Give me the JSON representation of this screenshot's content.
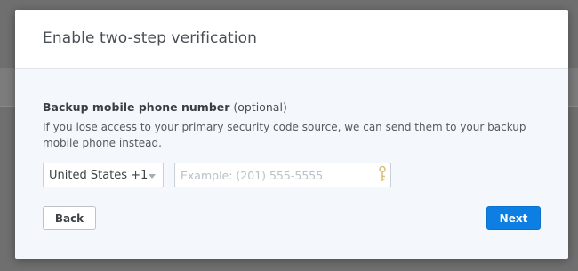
{
  "dialog": {
    "title": "Enable two-step verification"
  },
  "backup_phone": {
    "label": "Backup mobile phone number",
    "optional_note": "(optional)",
    "description": "If you lose access to your primary security code source, we can send them to your backup mobile phone instead.",
    "country_select": {
      "selected": "United States +1"
    },
    "phone_input": {
      "value": "",
      "placeholder": "Example: (201) 555-5555"
    }
  },
  "actions": {
    "back_label": "Back",
    "next_label": "Next"
  },
  "colors": {
    "primary_button": "#0d7fe3",
    "backdrop": "#6f6f6f",
    "dialog_body": "#f4f7fb",
    "key_icon": "#d9c27a"
  },
  "icons": {
    "select_arrow": "chevron-down-icon",
    "input_badge": "key-icon"
  }
}
